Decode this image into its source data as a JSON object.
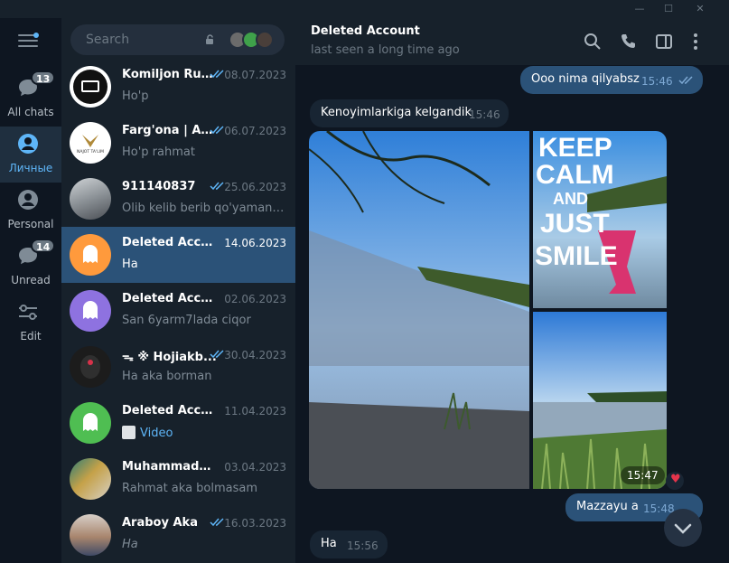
{
  "window": {
    "controls": {
      "minimize": "—",
      "maximize": "☐",
      "close": "✕"
    }
  },
  "rail": {
    "folders": [
      {
        "label": "All chats",
        "badge": "13",
        "icon": "chat-bubble-icon"
      },
      {
        "label": "Личные",
        "badge": "",
        "icon": "user-icon",
        "active": true
      },
      {
        "label": "Personal",
        "badge": "",
        "icon": "user-icon"
      },
      {
        "label": "Unread",
        "badge": "14",
        "icon": "chat-bubble-icon"
      },
      {
        "label": "Edit",
        "badge": "",
        "icon": "sliders-icon"
      }
    ]
  },
  "search": {
    "placeholder": "Search"
  },
  "chats": [
    {
      "name": "Komiljon Rust...",
      "date": "08.07.2023",
      "message": "Ho'p",
      "read": true
    },
    {
      "name": "Farg'ona | Ad...",
      "date": "06.07.2023",
      "message": "Ho'p rahmat",
      "read": true,
      "avatar_text": "NAJOT TA'LIM"
    },
    {
      "name": "911140837",
      "date": "25.06.2023",
      "message": "Olib kelib berib qo'yaman Ak...",
      "read": true
    },
    {
      "name": "Deleted Account",
      "date": "14.06.2023",
      "message": "Ha",
      "read": false,
      "active": true
    },
    {
      "name": "Deleted Account",
      "date": "02.06.2023",
      "message": "San 6yarm7lada ciqor",
      "read": false
    },
    {
      "name": "ᯓ ※ Hojiakb...",
      "date": "30.04.2023",
      "message": "Ha aka borman",
      "read": true
    },
    {
      "name": "Deleted Account",
      "date": "11.04.2023",
      "message": "Video",
      "read": false
    },
    {
      "name": "Muhammadyusuf",
      "date": "03.04.2023",
      "message": "Rahmat aka bolmasam",
      "read": false
    },
    {
      "name": "Araboy Aka",
      "date": "16.03.2023",
      "message": "Ha",
      "read": true
    }
  ],
  "header": {
    "title": "Deleted Account",
    "status": "last seen a long time ago"
  },
  "messages": {
    "m1": {
      "text": "Ooo nima qilyabsz",
      "time": "15:46"
    },
    "m2": {
      "text": "Kenoyimlarkiga kelgandik",
      "time": "15:46"
    },
    "album": {
      "time": "15:47",
      "reaction": "♥",
      "photo_text": [
        "KEEP",
        "CALM",
        "AND",
        "JUST",
        "SMILE"
      ]
    },
    "m3": {
      "text": "Mazzayu a",
      "time": "15:48"
    },
    "m4": {
      "text": "Ha",
      "time": "15:56"
    }
  },
  "colors": {
    "accent": "#5eb5f7",
    "outgoing": "#2b5278",
    "incoming": "#182533",
    "sidebar": "#17212b",
    "bg": "#0e1621"
  }
}
